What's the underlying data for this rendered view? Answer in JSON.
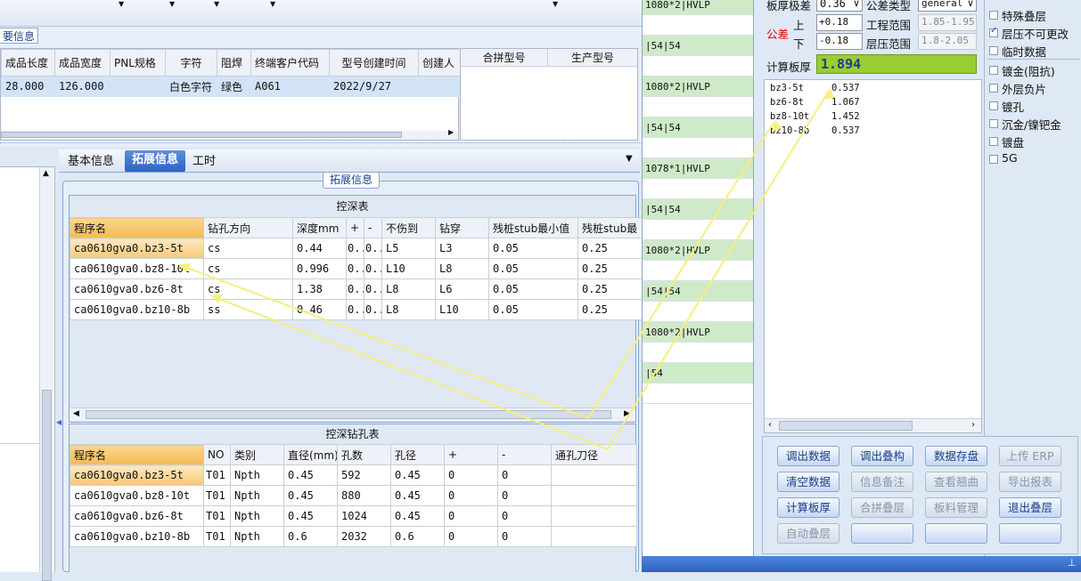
{
  "top_section": {
    "label": "要信息",
    "columns": [
      "成品长度",
      "成品宽度",
      "PNL规格",
      "字符",
      "阻焊",
      "终端客户代码",
      "型号创建时间",
      "创建人"
    ],
    "row": [
      "28.000",
      "126.000",
      "",
      "白色字符",
      "绿色",
      "A061",
      "2022/9/27",
      ""
    ]
  },
  "mid_panel": {
    "columns": [
      "合拼型号",
      "生产型号"
    ]
  },
  "tabs": [
    "基本信息",
    "拓展信息",
    "工时"
  ],
  "active_tab": "拓展信息",
  "group_title": "拓展信息",
  "depth_table": {
    "title": "控深表",
    "columns": [
      "程序名",
      "钻孔方向",
      "深度mm",
      "+",
      "-",
      "不伤到",
      "钻穿",
      "残桩stub最小值",
      "残桩stub最"
    ],
    "rows": [
      [
        "ca0610gva0.bz3-5t",
        "cs",
        "0.44",
        "0..",
        "0..",
        "L5",
        "L3",
        "0.05",
        "0.25"
      ],
      [
        "ca0610gva0.bz8-10t",
        "cs",
        "0.996",
        "0..",
        "0..",
        "L10",
        "L8",
        "0.05",
        "0.25"
      ],
      [
        "ca0610gva0.bz6-8t",
        "cs",
        "1.38",
        "0..",
        "0..",
        "L8",
        "L6",
        "0.05",
        "0.25"
      ],
      [
        "ca0610gva0.bz10-8b",
        "ss",
        "0.46",
        "0..",
        "0..",
        "L8",
        "L10",
        "0.05",
        "0.25"
      ]
    ]
  },
  "drill_table": {
    "title": "控深钻孔表",
    "columns": [
      "程序名",
      "NO",
      "类别",
      "直径(mm)",
      "孔数",
      "孔径",
      "+",
      "-",
      "通孔刀径"
    ],
    "rows": [
      [
        "ca0610gva0.bz3-5t",
        "T01",
        "Npth",
        "0.45",
        "592",
        "0.45",
        "0",
        "0",
        ""
      ],
      [
        "ca0610gva0.bz8-10t",
        "T01",
        "Npth",
        "0.45",
        "880",
        "0.45",
        "0",
        "0",
        ""
      ],
      [
        "ca0610gva0.bz6-8t",
        "T01",
        "Npth",
        "0.45",
        "1024",
        "0.45",
        "0",
        "0",
        ""
      ],
      [
        "ca0610gva0.bz10-8b",
        "T01",
        "Npth",
        "0.6",
        "2032",
        "0.6",
        "0",
        "0",
        ""
      ]
    ]
  },
  "stack_list": [
    "1080*2|HVLP",
    "",
    "|54|54",
    "",
    "1080*2|HVLP",
    "",
    "|54|54",
    "",
    "1078*1|HVLP",
    "",
    "|54|54",
    "",
    "1080*2|HVLP",
    "",
    "|54|54",
    "",
    "1080*2|HVLP",
    "",
    "|54",
    ""
  ],
  "thickness_panel": {
    "tolerance_label": "板厚极差",
    "tolerance_value": "0.36",
    "tol_type_label": "公差类型",
    "tol_type_value": "general",
    "gongcha_label": "公差",
    "upper_label": "上",
    "upper_value": "+0.18",
    "lower_label": "下",
    "lower_value": "-0.18",
    "eng_range_label": "工程范围",
    "eng_range_value": "1.85-1.95",
    "press_range_label": "层压范围",
    "press_range_value": "1.8-2.05",
    "calc_label": "计算板厚",
    "calc_value": "1.894"
  },
  "bz_list": [
    {
      "name": "bz3-5t",
      "value": "0.537"
    },
    {
      "name": "bz6-8t",
      "value": "1.067"
    },
    {
      "name": "bz8-10t",
      "value": "1.452"
    },
    {
      "name": "bz10-8b",
      "value": "0.537"
    }
  ],
  "checkboxes": [
    {
      "label": "特殊叠层",
      "checked": false
    },
    {
      "label": "层压不可更改",
      "checked": true
    },
    {
      "label": "临时数据",
      "checked": false
    },
    {
      "label": "镀金(阻抗)",
      "checked": false
    },
    {
      "label": "外层负片",
      "checked": false
    },
    {
      "label": "镀孔",
      "checked": false
    },
    {
      "label": "沉金/镍钯金",
      "checked": false
    },
    {
      "label": "镀盘",
      "checked": false
    },
    {
      "label": "5G",
      "checked": false
    }
  ],
  "buttons": [
    [
      "调出数据",
      "调出叠构",
      "数据存盘",
      "上传 ERP"
    ],
    [
      "清空数据",
      "信息备注",
      "查看翘曲",
      "导出报表"
    ],
    [
      "计算板厚",
      "合拼叠层",
      "板料管理",
      "退出叠层"
    ],
    [
      "自动叠层",
      "",
      "",
      ""
    ]
  ],
  "colors": {
    "accent": "#3a6fc9",
    "green_field": "#9acd32",
    "stack_green": "#cfeac9",
    "arrow": "#f4f07a"
  }
}
